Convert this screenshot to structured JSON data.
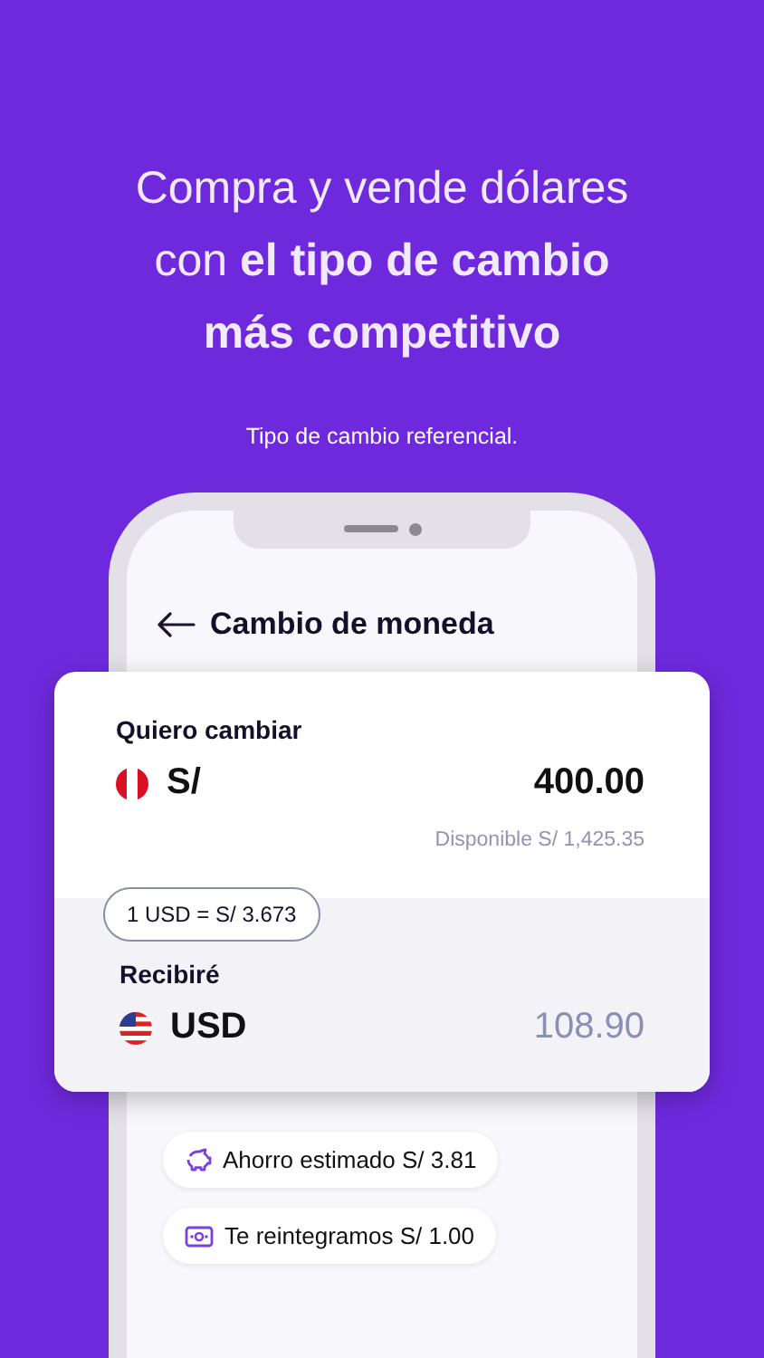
{
  "headline": "Compra y vende dólares\ncon **el tipo de cambio**\n**más competitivo**",
  "subtitle": "Tipo de cambio referencial.",
  "screen": {
    "title": "Cambio de moneda",
    "send": {
      "label": "Quiero cambiar",
      "kind": "pe",
      "currency": "S/",
      "amount": "400.00",
      "available": "Disponible S/ 1,425.35"
    },
    "rate": "1 USD = S/ 3.673",
    "receive": {
      "label": "Recibiré",
      "kind": "us",
      "currency": "USD",
      "amount": "108.90"
    },
    "chips": [
      {
        "kind": "piggy",
        "text": "Ahorro estimado S/ 3.81"
      },
      {
        "kind": "bill",
        "text": "Te reintegramos S/ 1.00"
      }
    ]
  }
}
